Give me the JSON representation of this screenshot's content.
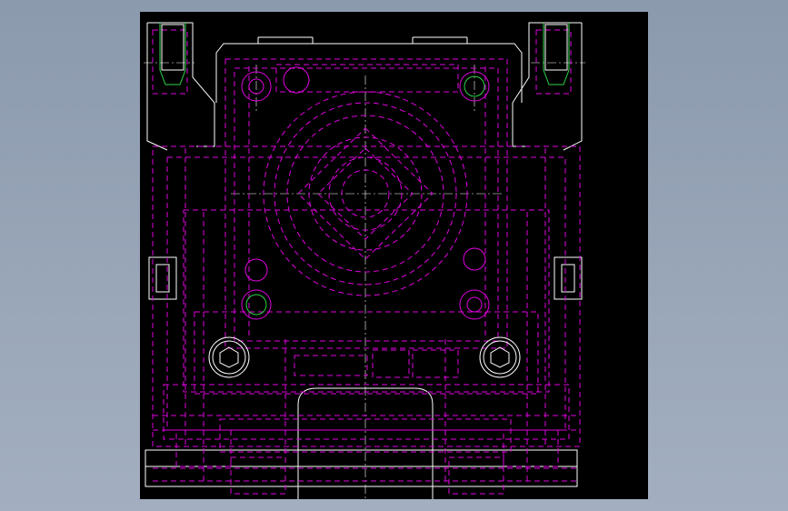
{
  "drawing": {
    "background": "#000000",
    "outline_color": "#ffffff",
    "hidden_line_color": "#e000e0",
    "thread_color": "#2fd24a",
    "page_background": "#9aa7b9"
  }
}
